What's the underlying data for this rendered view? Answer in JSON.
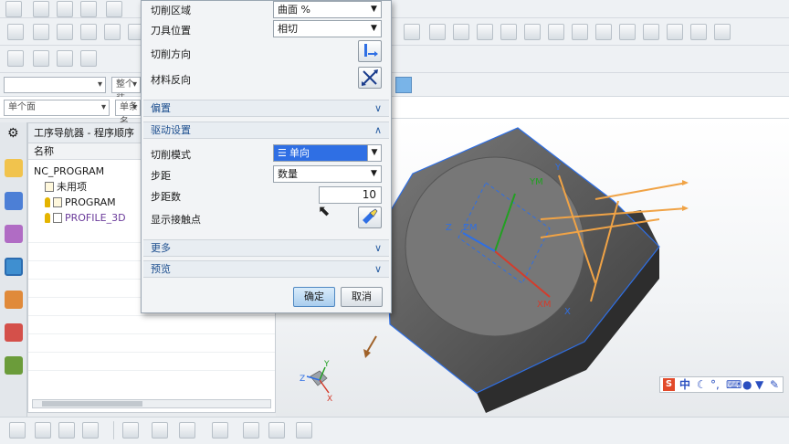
{
  "app": {
    "combo_filter_placeholder": "整个装",
    "combo_selection": "单个面",
    "combo_scope": "单条名"
  },
  "navigator": {
    "title": "工序导航器 - 程序顺序",
    "column_name": "名称",
    "items": [
      {
        "label": "NC_PROGRAM"
      },
      {
        "label": "未用项"
      },
      {
        "label": "PROGRAM"
      },
      {
        "label": "PROFILE_3D",
        "color": "#6a3a9a"
      }
    ]
  },
  "dialog": {
    "rows": {
      "cut_region": {
        "label": "切削区域",
        "value": "曲面 %"
      },
      "tool_position": {
        "label": "刀具位置",
        "value": "相切"
      },
      "cut_direction": {
        "label": "切削方向"
      },
      "material_reverse": {
        "label": "材料反向"
      }
    },
    "sections": {
      "offset": "偏置",
      "drive_settings": "驱动设置",
      "more": "更多",
      "preview": "预览"
    },
    "drive": {
      "cut_mode": {
        "label": "切削模式",
        "value": "单向"
      },
      "stepover": {
        "label": "步距",
        "value": "数量"
      },
      "step_count": {
        "label": "步距数",
        "value": "10"
      },
      "show_contact": {
        "label": "显示接触点"
      }
    },
    "buttons": {
      "ok": "确定",
      "cancel": "取消"
    }
  },
  "viewport": {
    "axis_labels": {
      "ym": "YM",
      "zm": "ZM",
      "xm": "XM",
      "z": "Z",
      "x": "X",
      "y": "Y"
    },
    "triad": {
      "x": "X",
      "y": "Y",
      "z": "Z"
    },
    "colors": {
      "accent_blue": "#2f6fe4",
      "part_dark": "#3a3a3a",
      "tool_orange": "#f0a346"
    }
  },
  "ime": {
    "logo": "S",
    "lang": "中"
  }
}
